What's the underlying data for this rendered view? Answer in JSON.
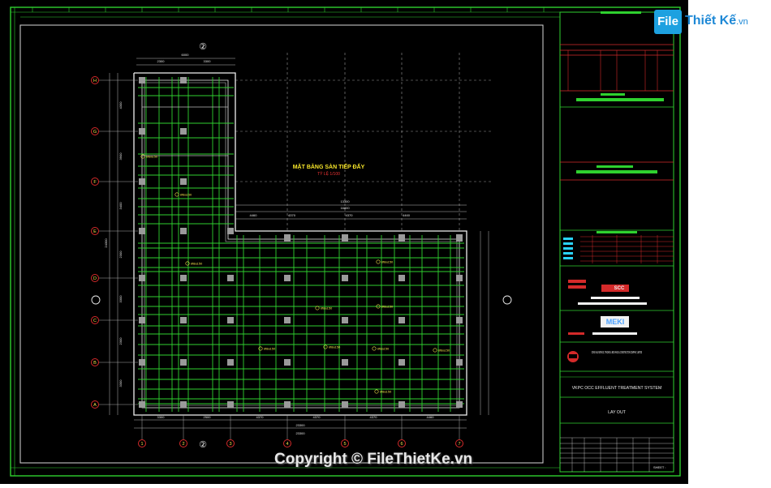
{
  "watermark": {
    "logo_box": "File",
    "logo_text": "Thiết Kế",
    "logo_suffix": ".vn",
    "copyright": "Copyright © FileThietKe.vn"
  },
  "drawing": {
    "title": "MẶT BẰNG SÀN TIẾP ĐẤY",
    "subtitle": "TỶ LỆ 1/100",
    "section_mark": "②",
    "grid_rows": [
      "H",
      "G",
      "F",
      "E",
      "D",
      "C",
      "B",
      "A"
    ],
    "grid_cols": [
      "1",
      "2",
      "3",
      "4",
      "5",
      "6",
      "7"
    ],
    "top_dims": [
      "6000",
      "2300",
      "3300"
    ],
    "mid_dims": [
      "13300",
      "16800"
    ],
    "span_dims": [
      "4460",
      "4370",
      "4370",
      "4460"
    ],
    "bottom_dims": [
      "3300",
      "2500",
      "4370",
      "4370",
      "4370",
      "4460",
      "23300"
    ],
    "left_dims": [
      "4300",
      "3900",
      "3400",
      "2300",
      "3300",
      "2300",
      "3300",
      "24300"
    ],
    "rebar_labels": [
      "Ø8a150",
      "Ø8a150",
      "Ø8a150",
      "Ø8a150",
      "Ø8a150",
      "Ø8a150",
      "Ø8a150",
      "Ø8a150",
      "Ø8a150",
      "Ø8a150",
      "Ø8a150"
    ]
  },
  "title_block": {
    "company": "DONG HUU SERVICE, TRADING & MECHANICAL CONSTRUCTION COMPANY, LIMITED",
    "project": "VKPC OCC EFFLUENT TREATMENT SYSTEM",
    "sheet_title": "LAY OUT",
    "logo_top": "SCC",
    "logo_mid": "MEKI",
    "sheet_label": "SHEET :"
  }
}
